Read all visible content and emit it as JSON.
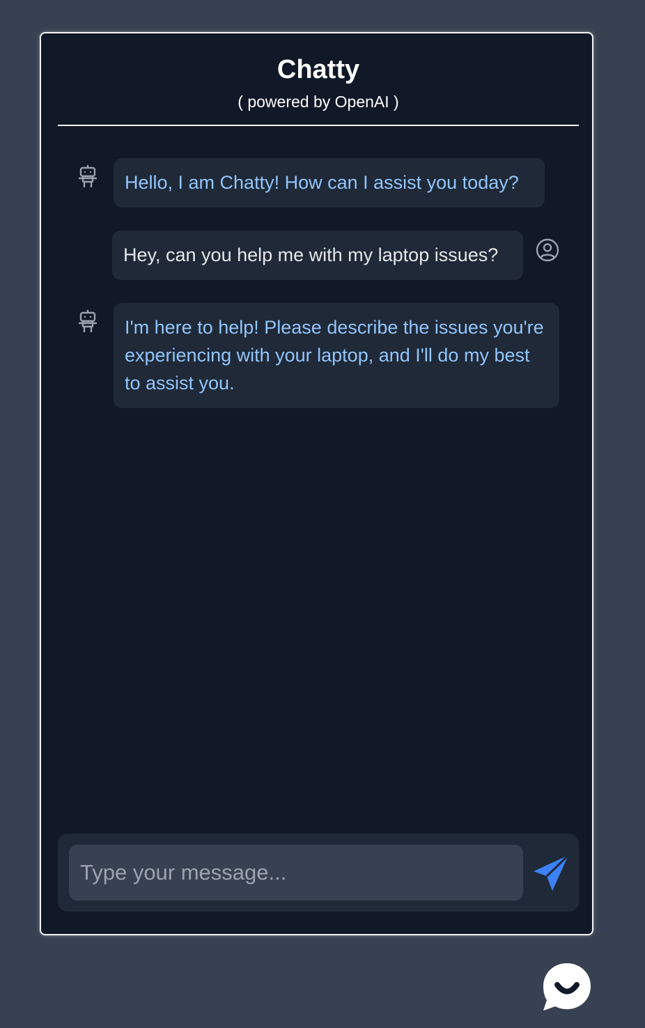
{
  "chat": {
    "title": "Chatty",
    "subtitle": "( powered by OpenAI )"
  },
  "messages": [
    {
      "sender": "bot",
      "text": "Hello, I am Chatty! How can I assist you today?",
      "icon": "robot-icon"
    },
    {
      "sender": "user",
      "text": "Hey, can you help me with my laptop issues?",
      "icon": "user-icon"
    },
    {
      "sender": "bot",
      "text": "I'm here to help! Please describe the issues you're experiencing with your laptop, and I'll do my best to assist you.",
      "icon": "robot-icon"
    }
  ],
  "composer": {
    "placeholder": "Type your message...",
    "value": "",
    "send_icon": "send-icon"
  },
  "launcher": {
    "icon": "chat-bubble-icon"
  },
  "colors": {
    "page_bg": "#374151",
    "window_bg": "#111827",
    "bubble_bg": "#1f2937",
    "bot_text": "#93c5fd",
    "user_text": "#e5e7eb",
    "accent": "#3b82f6"
  }
}
